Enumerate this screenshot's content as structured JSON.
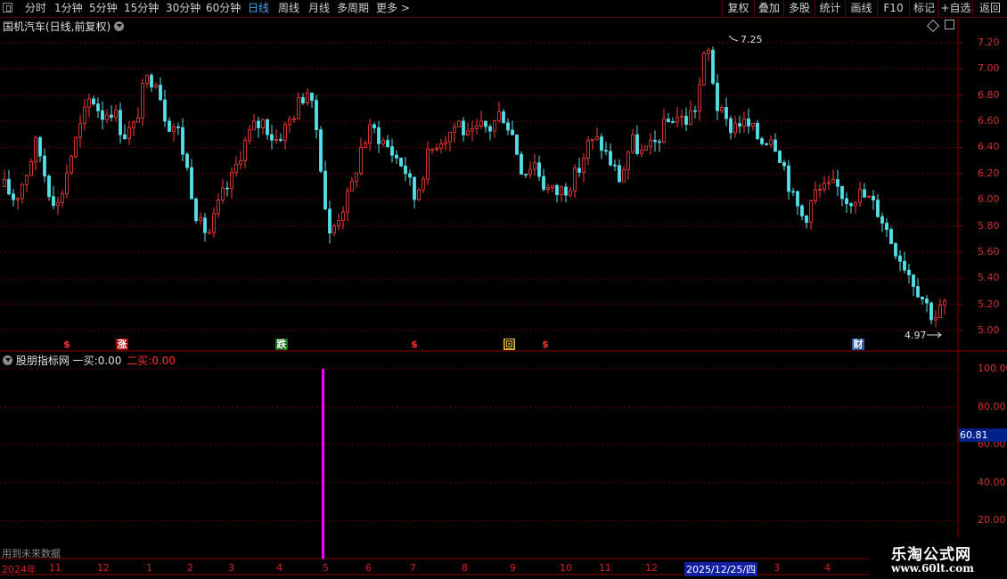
{
  "toolbar": {
    "timeframes": [
      "分时",
      "1分钟",
      "5分钟",
      "15分钟",
      "30分钟",
      "60分钟",
      "日线",
      "周线",
      "月线",
      "多周期",
      "更多 >"
    ],
    "active_timeframe": "日线",
    "buttons": [
      "复权",
      "叠加",
      "多股",
      "统计",
      "画线",
      "F10",
      "标记",
      "+自选",
      "返回"
    ]
  },
  "main_panel": {
    "title": "国机汽车(日线,前复权)",
    "price_axis": [
      "7.20",
      "7.00",
      "6.80",
      "6.60",
      "6.40",
      "6.20",
      "6.00",
      "5.80",
      "5.60",
      "5.40",
      "5.20",
      "5.00"
    ],
    "high_marker": "7.25",
    "low_marker": "4.97",
    "signals": [
      {
        "text": "$",
        "kind": "dollar"
      },
      {
        "text": "涨",
        "kind": "rise"
      },
      {
        "text": "跌",
        "kind": "fall"
      },
      {
        "text": "$",
        "kind": "dollar"
      },
      {
        "text": "回",
        "kind": "return"
      },
      {
        "text": "$",
        "kind": "dollar"
      },
      {
        "text": "财",
        "kind": "finance"
      }
    ]
  },
  "indicator_panel": {
    "name": "股朋指标网",
    "buy1_label": "一买:",
    "buy1_value": "0.00",
    "buy2_label": "二买:",
    "buy2_value": "0.00",
    "axis": [
      "100.00",
      "80.00",
      "60.00",
      "40.00",
      "20.00"
    ],
    "current_value": "60.81",
    "footer_note": "用到未来数据"
  },
  "date_axis": {
    "labels": [
      "2024年",
      "11",
      "12",
      "1",
      "2",
      "3",
      "4",
      "5",
      "6",
      "7",
      "8",
      "9",
      "10",
      "11",
      "12",
      "2025/12/25/四",
      "3",
      "4"
    ],
    "cursor_date": "2025/12/25/四"
  },
  "watermark": {
    "line1": "乐淘公式网",
    "line2": "www.60lt.com"
  },
  "colors": {
    "up": "#ff3b3b",
    "down": "#54e0e8",
    "grid": "#7a0000",
    "accent": "#3fa9f5",
    "indicator_bar": "#ff00ff"
  },
  "chart_data": {
    "type": "candlestick",
    "ylim": [
      4.9,
      7.3
    ],
    "y_ticks": [
      5.0,
      5.2,
      5.4,
      5.6,
      5.8,
      6.0,
      6.2,
      6.4,
      6.6,
      6.8,
      7.0,
      7.2
    ],
    "max_price": 7.25,
    "min_price": 4.97,
    "close_path": [
      6.1,
      6.0,
      6.2,
      6.45,
      6.1,
      5.95,
      6.3,
      6.55,
      6.8,
      6.65,
      6.7,
      6.5,
      6.55,
      6.9,
      6.95,
      6.6,
      6.55,
      6.2,
      5.8,
      5.75,
      6.0,
      6.15,
      6.4,
      6.55,
      6.6,
      6.45,
      6.55,
      6.7,
      6.85,
      6.5,
      5.7,
      5.9,
      6.05,
      6.4,
      6.55,
      6.45,
      6.35,
      6.25,
      6.0,
      6.3,
      6.45,
      6.5,
      6.6,
      6.45,
      6.55,
      6.55,
      6.68,
      6.5,
      6.2,
      6.3,
      6.1,
      6.05,
      6.1,
      6.2,
      6.42,
      6.45,
      6.3,
      6.15,
      6.45,
      6.35,
      6.4,
      6.55,
      6.65,
      6.6,
      6.72,
      7.2,
      6.7,
      6.55,
      6.6,
      6.55,
      6.45,
      6.5,
      6.3,
      6.0,
      5.85,
      6.05,
      6.08,
      6.1,
      6.0,
      6.05,
      6.0,
      5.9,
      5.7,
      5.55,
      5.4,
      5.25,
      5.1,
      5.2
    ],
    "indicator": {
      "ylim": [
        0,
        110
      ],
      "bar_value": 100,
      "current_value": 60.81
    }
  }
}
